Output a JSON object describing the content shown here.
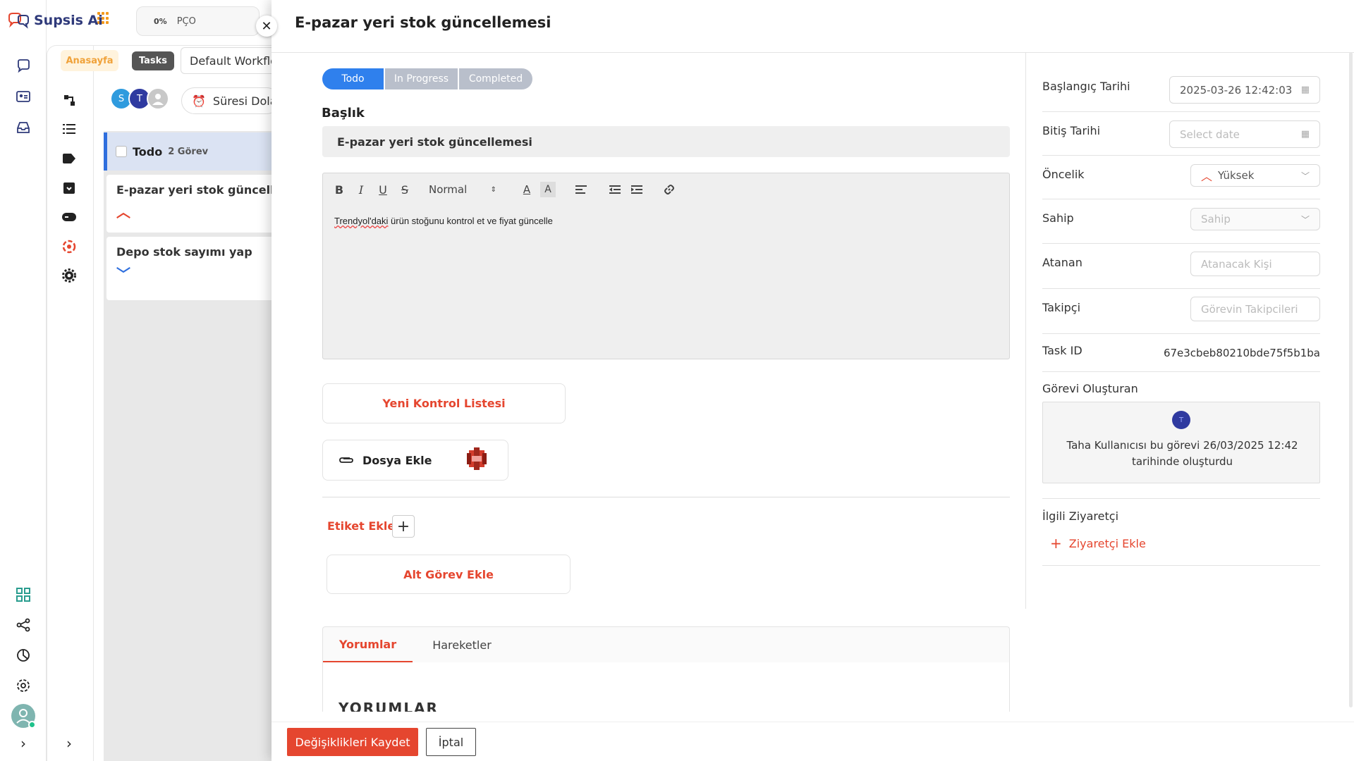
{
  "app": {
    "brand": "Supsis Ai"
  },
  "topbar": {
    "progress_percent": "0%",
    "progress_label": "PÇO"
  },
  "breadcrumb": {
    "home": "Anasayfa",
    "tasks": "Tasks",
    "workflow": "Default Workflow"
  },
  "board": {
    "avatars": [
      "S",
      "T",
      ""
    ],
    "expire_filter": "Süresi Dolan",
    "column": {
      "title": "Todo",
      "count_label": "2 Görev"
    },
    "cards": [
      {
        "title": "E-pazar yeri stok güncellemesi",
        "priority": "high"
      },
      {
        "title": "Depo stok sayımı yap",
        "priority": "low"
      }
    ]
  },
  "task": {
    "header_title": "E-pazar yeri stok güncellemesi",
    "status_tabs": [
      "Todo",
      "In Progress",
      "Completed"
    ],
    "active_status": "Todo",
    "title_label": "Başlık",
    "title_value": "E-pazar yeri stok güncellemesi",
    "editor": {
      "format_select": "Normal",
      "content_underlined": "Trendyol'daki",
      "content_rest": " ürün stoğunu kontrol et ve fiyat güncelle"
    },
    "new_checklist": "Yeni Kontrol Listesi",
    "add_file": "Dosya Ekle",
    "add_tag": "Etiket Ekle",
    "add_subtask": "Alt Görev Ekle",
    "tabs": [
      "Yorumlar",
      "Hareketler"
    ],
    "comments_heading": "YORUMLAR"
  },
  "details": {
    "start_date_label": "Başlangıç Tarihi",
    "start_date_value": "2025-03-26 12:42:03",
    "end_date_label": "Bitiş Tarihi",
    "end_date_placeholder": "Select date",
    "priority_label": "Öncelik",
    "priority_value": "Yüksek",
    "owner_label": "Sahip",
    "owner_placeholder": "Sahip",
    "assignee_label": "Atanan",
    "assignee_placeholder": "Atanacak Kişi",
    "follower_label": "Takipçi",
    "follower_placeholder": "Görevin Takipcileri",
    "task_id_label": "Task ID",
    "task_id_value": "67e3cbeb80210bde75f5b1ba",
    "creator_label": "Görevi Oluşturan",
    "creator_initial": "T",
    "creator_text": "Taha Kullanıcısı bu görevi 26/03/2025 12:42 tarihinde oluşturdu",
    "visitor_label": "İlgili Ziyaretçi",
    "add_visitor": "Ziyaretçi Ekle"
  },
  "footer": {
    "save": "Değişiklikleri Kaydet",
    "cancel": "İptal"
  },
  "colors": {
    "accent_red": "#e5462f",
    "active_blue": "#2f80ed",
    "brand_navy": "#2f3a7a"
  }
}
